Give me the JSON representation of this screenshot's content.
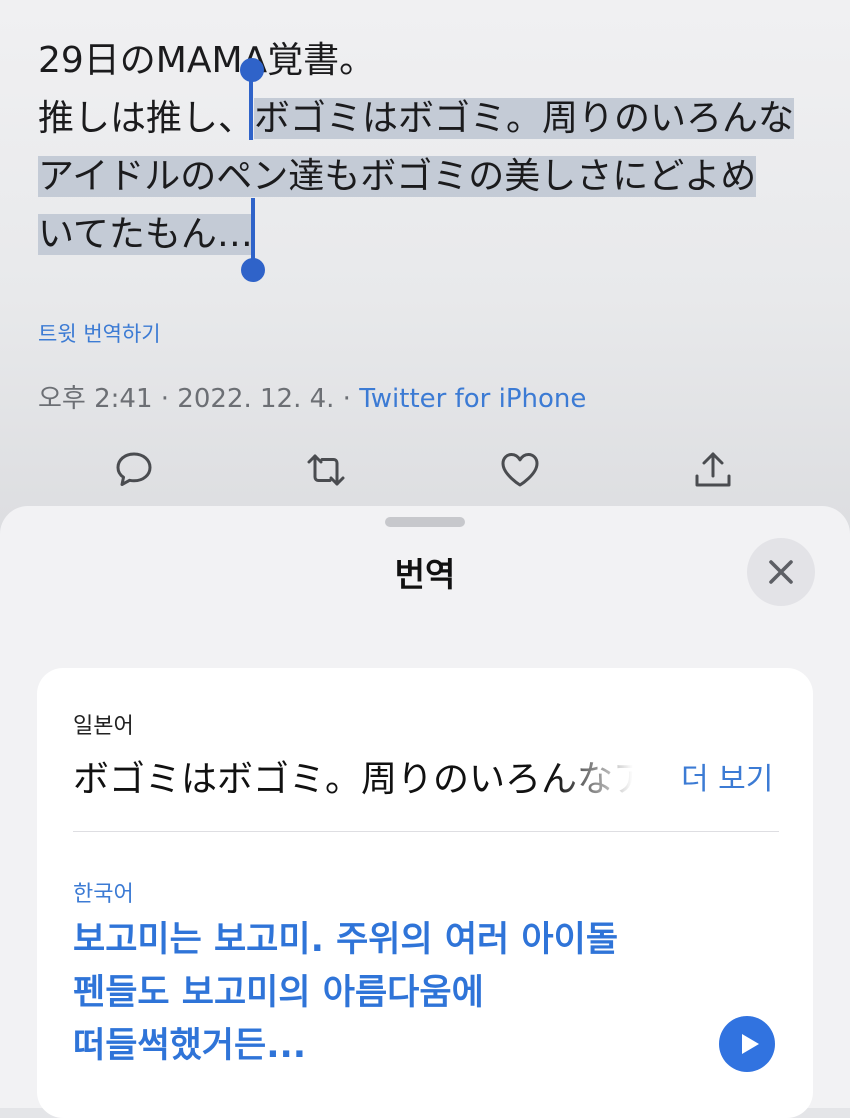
{
  "tweet": {
    "text_line1": "29日のMAMA覚書。",
    "text_line2_plain": "推しは推し、",
    "text_line2_selected": "ボゴミはボゴミ。周りのいろんな",
    "text_line3_selected": "アイドルのペン達もボゴミの美しさにどよめ",
    "text_line4_selected": "いてたもん…",
    "translate_link": "트윗 번역하기",
    "meta_time": "오후 2:41 · 2022. 12. 4. · ",
    "meta_source": "Twitter for iPhone",
    "actions": [
      "reply-icon",
      "retweet-icon",
      "like-icon",
      "share-icon"
    ]
  },
  "sheet": {
    "title": "번역",
    "close_icon": "close-icon",
    "source_language": "일본어",
    "source_text": "ボゴミはボゴミ。周りのいろんなア",
    "more_label": "더 보기",
    "target_language": "한국어",
    "target_line1": "보고미는 보고미. 주위의 여러 아이돌",
    "target_line2": "펜들도 보고미의 아름다움에",
    "target_line3": "떠들썩했거든...",
    "play_icon": "play-icon"
  },
  "colors": {
    "accent": "#3c7bd4",
    "selection": "#c4cbd6",
    "handle": "#2f63c9",
    "play_button": "#3173e0"
  }
}
